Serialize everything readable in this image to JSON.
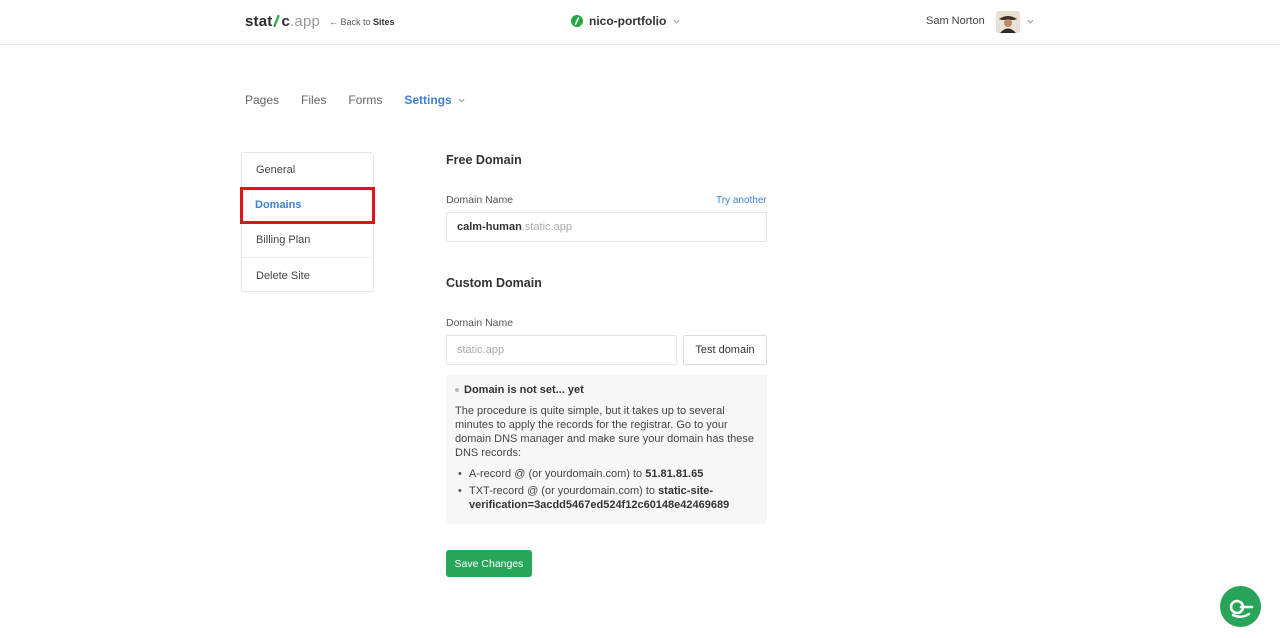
{
  "header": {
    "logo_main": "stat",
    "logo_tail": "c",
    "logo_domain": ".app",
    "back_prefix": "← Back to ",
    "back_target": "Sites",
    "site_name": "nico-portfolio",
    "user_name": "Sam Norton"
  },
  "tabs": [
    {
      "label": "Pages"
    },
    {
      "label": "Files"
    },
    {
      "label": "Forms"
    },
    {
      "label": "Settings"
    }
  ],
  "sidebar": {
    "items": [
      {
        "label": "General"
      },
      {
        "label": "Domains"
      },
      {
        "label": "Billing Plan"
      },
      {
        "label": "Delete Site"
      }
    ]
  },
  "free_domain": {
    "title": "Free Domain",
    "label": "Domain Name",
    "try_another": "Try another",
    "subdomain": "calm-human",
    "suffix": ".static.app"
  },
  "custom_domain": {
    "title": "Custom Domain",
    "label": "Domain Name",
    "placeholder": "static.app",
    "test_button": "Test domain",
    "status_title": "Domain is not set... yet",
    "description": "The procedure is quite simple, but it takes up to several minutes to apply the records for the registrar. Go to your domain DNS manager and make sure your domain has these DNS records:",
    "records": [
      {
        "prefix": "A-record @ (or yourdomain.com) to ",
        "value": "51.81.81.65"
      },
      {
        "prefix": "TXT-record @ (or yourdomain.com) to ",
        "value": "static-site-verification=3acdd5467ed524f12c60148e42469689"
      }
    ]
  },
  "actions": {
    "save_label": "Save Changes"
  },
  "colors": {
    "accent": "#3b82d6",
    "primary_green": "#28a65b",
    "highlight_red": "#e0151a"
  }
}
